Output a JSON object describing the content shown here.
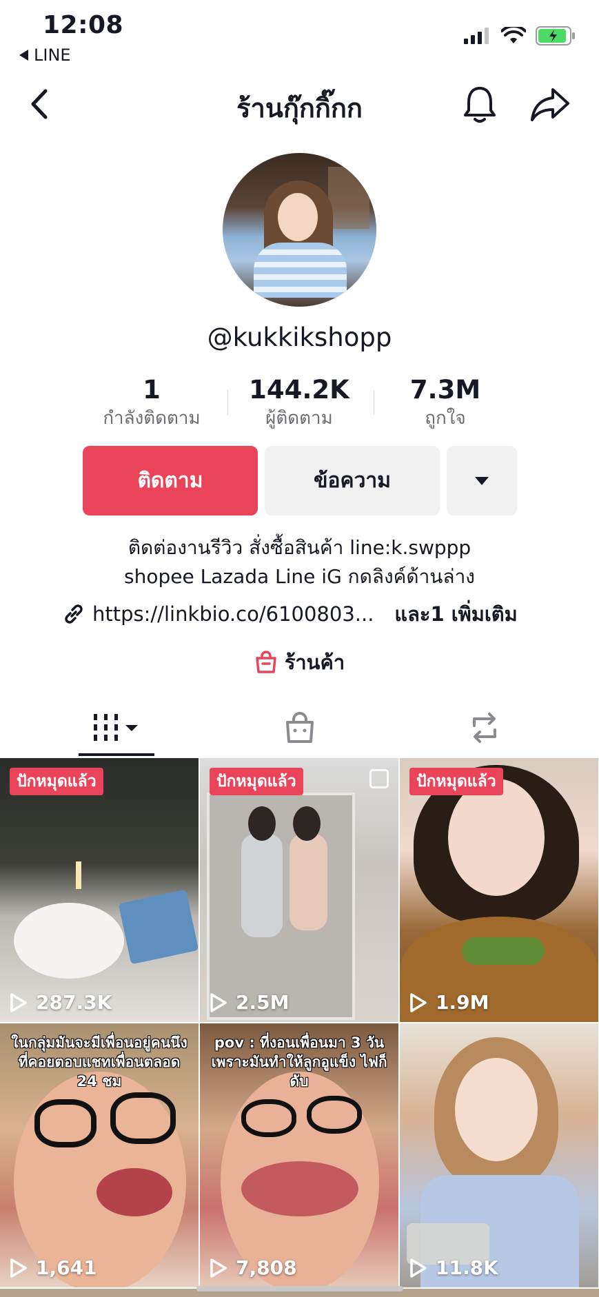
{
  "status_bar": {
    "time": "12:08",
    "back_app": "LINE"
  },
  "header": {
    "title": "ร้านกุ๊กกิ๊กก"
  },
  "profile": {
    "handle": "@kukkikshopp",
    "stats": [
      {
        "value": "1",
        "label": "กำลังติดตาม"
      },
      {
        "value": "144.2K",
        "label": "ผู้ติดตาม"
      },
      {
        "value": "7.3M",
        "label": "ถูกใจ"
      }
    ],
    "follow_label": "ติดตาม",
    "message_label": "ข้อความ",
    "bio_line1": "ติดต่องานรีวิว สั่งซื้อสินค้า line:k.swppp",
    "bio_line2": "shopee Lazada Line iG กดลิงค์ด้านล่าง",
    "link": "https://linkbio.co/6100803...",
    "link_more": "และ1 เพิ่มเติม",
    "shop_label": "ร้านค้า"
  },
  "colors": {
    "accent": "#ea445a",
    "button_gray": "#f1f1f2",
    "text": "#161823"
  },
  "videos": [
    {
      "pinned": "ปักหมุดแล้ว",
      "views": "287.3K",
      "caption": ""
    },
    {
      "pinned": "ปักหมุดแล้ว",
      "views": "2.5M",
      "caption": ""
    },
    {
      "pinned": "ปักหมุดแล้ว",
      "views": "1.9M",
      "caption": ""
    },
    {
      "pinned": "",
      "views": "1,641",
      "caption": "ในกลุ่มมันจะมีเพื่อนอยู่คนนึงที่คอยตอบแชทเพื่อนตลอด 24 ชม"
    },
    {
      "pinned": "",
      "views": "7,808",
      "caption": "pov : ที่งอนเพื่อนมา 3 วันเพราะมันทำให้ลูกอูแข็ง ไฟก็ดับ"
    },
    {
      "pinned": "",
      "views": "11.8K",
      "caption": ""
    }
  ]
}
